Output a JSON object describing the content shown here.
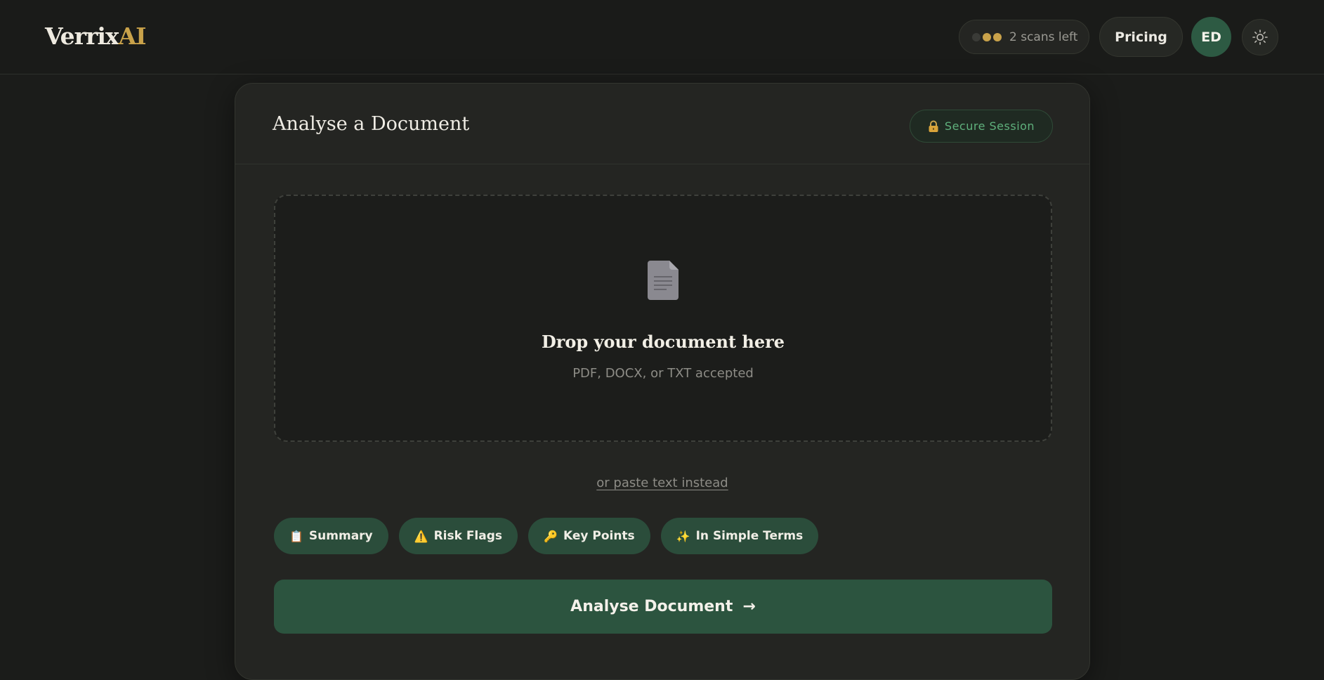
{
  "header": {
    "logo_part1": "Verrix",
    "logo_part2": "AI",
    "scans_label": "2 scans left",
    "pricing_label": "Pricing",
    "avatar_initials": "ED",
    "theme_icon": "sun-icon"
  },
  "card": {
    "title": "Analyse a Document",
    "secure_label": "Secure Session",
    "secure_icon": "lock-icon",
    "dropzone": {
      "icon": "document-icon",
      "title": "Drop your document here",
      "subtitle": "PDF, DOCX, or TXT accepted"
    },
    "paste_link": "or paste text instead",
    "chips": [
      {
        "emoji": "📋",
        "label": "Summary"
      },
      {
        "emoji": "⚠️",
        "label": "Risk Flags"
      },
      {
        "emoji": "🔑",
        "label": "Key Points"
      },
      {
        "emoji": "✨",
        "label": "In Simple Terms"
      }
    ],
    "analyse_label": "Analyse Document",
    "analyse_arrow": "→"
  },
  "colors": {
    "background": "#1b1c1a",
    "accent_green": "#2c543f",
    "gold": "#c9a24a",
    "secure_green": "#5fb07c"
  }
}
